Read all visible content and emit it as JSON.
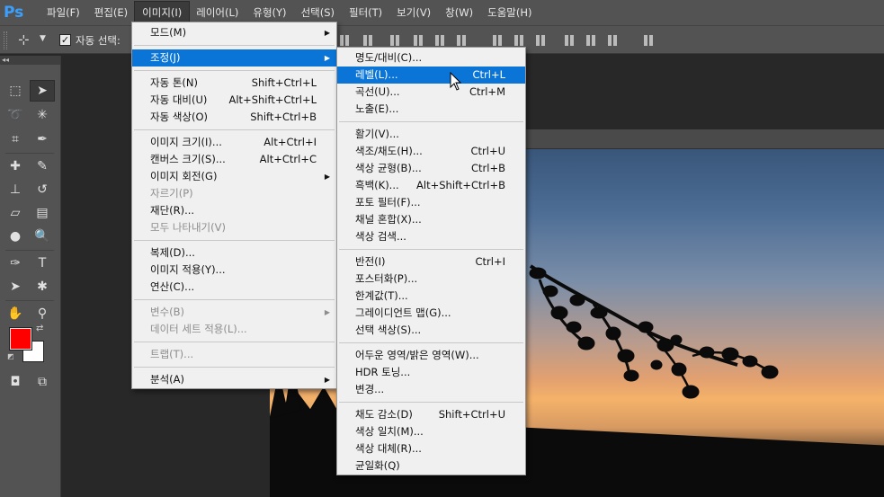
{
  "app": {
    "logo": "Ps",
    "menubar": [
      {
        "label": "파일(F)",
        "active": false
      },
      {
        "label": "편집(E)",
        "active": false
      },
      {
        "label": "이미지(I)",
        "active": true
      },
      {
        "label": "레이어(L)",
        "active": false
      },
      {
        "label": "유형(Y)",
        "active": false
      },
      {
        "label": "선택(S)",
        "active": false
      },
      {
        "label": "필터(T)",
        "active": false
      },
      {
        "label": "보기(V)",
        "active": false
      },
      {
        "label": "창(W)",
        "active": false
      },
      {
        "label": "도움말(H)",
        "active": false
      }
    ]
  },
  "options_bar": {
    "auto_select_label": "자동 선택:",
    "auto_select_checked": true,
    "move_icon": "move-tool-icon"
  },
  "tools_panel": {
    "collapse_glyph": "◂◂",
    "foreground_color": "#ff0000",
    "background_color": "#ffffff"
  },
  "image_menu": {
    "items": [
      {
        "label": "모드(M)",
        "shortcut": "",
        "submenu": true,
        "disabled": false
      },
      {
        "sep": true
      },
      {
        "label": "조정(J)",
        "shortcut": "",
        "submenu": true,
        "disabled": false,
        "highlighted": true
      },
      {
        "sep": true
      },
      {
        "label": "자동 톤(N)",
        "shortcut": "Shift+Ctrl+L",
        "submenu": false,
        "disabled": false
      },
      {
        "label": "자동 대비(U)",
        "shortcut": "Alt+Shift+Ctrl+L",
        "submenu": false,
        "disabled": false
      },
      {
        "label": "자동 색상(O)",
        "shortcut": "Shift+Ctrl+B",
        "submenu": false,
        "disabled": false
      },
      {
        "sep": true
      },
      {
        "label": "이미지 크기(I)...",
        "shortcut": "Alt+Ctrl+I",
        "submenu": false,
        "disabled": false
      },
      {
        "label": "캔버스 크기(S)...",
        "shortcut": "Alt+Ctrl+C",
        "submenu": false,
        "disabled": false
      },
      {
        "label": "이미지 회전(G)",
        "shortcut": "",
        "submenu": true,
        "disabled": false
      },
      {
        "label": "자르기(P)",
        "shortcut": "",
        "submenu": false,
        "disabled": true
      },
      {
        "label": "재단(R)...",
        "shortcut": "",
        "submenu": false,
        "disabled": false
      },
      {
        "label": "모두 나타내기(V)",
        "shortcut": "",
        "submenu": false,
        "disabled": true
      },
      {
        "sep": true
      },
      {
        "label": "복제(D)...",
        "shortcut": "",
        "submenu": false,
        "disabled": false
      },
      {
        "label": "이미지 적용(Y)...",
        "shortcut": "",
        "submenu": false,
        "disabled": false
      },
      {
        "label": "연산(C)...",
        "shortcut": "",
        "submenu": false,
        "disabled": false
      },
      {
        "sep": true
      },
      {
        "label": "변수(B)",
        "shortcut": "",
        "submenu": true,
        "disabled": true
      },
      {
        "label": "데이터 세트 적용(L)...",
        "shortcut": "",
        "submenu": false,
        "disabled": true
      },
      {
        "sep": true
      },
      {
        "label": "트랩(T)...",
        "shortcut": "",
        "submenu": false,
        "disabled": true
      },
      {
        "sep": true
      },
      {
        "label": "분석(A)",
        "shortcut": "",
        "submenu": true,
        "disabled": false
      }
    ]
  },
  "adjust_menu": {
    "items": [
      {
        "label": "명도/대비(C)...",
        "shortcut": ""
      },
      {
        "label": "레벨(L)...",
        "shortcut": "Ctrl+L",
        "highlighted": true
      },
      {
        "label": "곡선(U)...",
        "shortcut": "Ctrl+M"
      },
      {
        "label": "노출(E)...",
        "shortcut": ""
      },
      {
        "sep": true
      },
      {
        "label": "활기(V)...",
        "shortcut": ""
      },
      {
        "label": "색조/채도(H)...",
        "shortcut": "Ctrl+U"
      },
      {
        "label": "색상 균형(B)...",
        "shortcut": "Ctrl+B"
      },
      {
        "label": "흑백(K)...",
        "shortcut": "Alt+Shift+Ctrl+B"
      },
      {
        "label": "포토 필터(F)...",
        "shortcut": ""
      },
      {
        "label": "채널 혼합(X)...",
        "shortcut": ""
      },
      {
        "label": "색상 검색...",
        "shortcut": ""
      },
      {
        "sep": true
      },
      {
        "label": "반전(I)",
        "shortcut": "Ctrl+I"
      },
      {
        "label": "포스터화(P)...",
        "shortcut": ""
      },
      {
        "label": "한계값(T)...",
        "shortcut": ""
      },
      {
        "label": "그레이디언트 맵(G)...",
        "shortcut": ""
      },
      {
        "label": "선택 색상(S)...",
        "shortcut": ""
      },
      {
        "sep": true
      },
      {
        "label": "어두운 영역/밝은 영역(W)...",
        "shortcut": ""
      },
      {
        "label": "HDR 토닝...",
        "shortcut": ""
      },
      {
        "label": "변경...",
        "shortcut": ""
      },
      {
        "sep": true
      },
      {
        "label": "채도 감소(D)",
        "shortcut": "Shift+Ctrl+U"
      },
      {
        "label": "색상 일치(M)...",
        "shortcut": ""
      },
      {
        "label": "색상 대체(R)...",
        "shortcut": ""
      },
      {
        "label": "균일화(Q)",
        "shortcut": ""
      }
    ]
  }
}
